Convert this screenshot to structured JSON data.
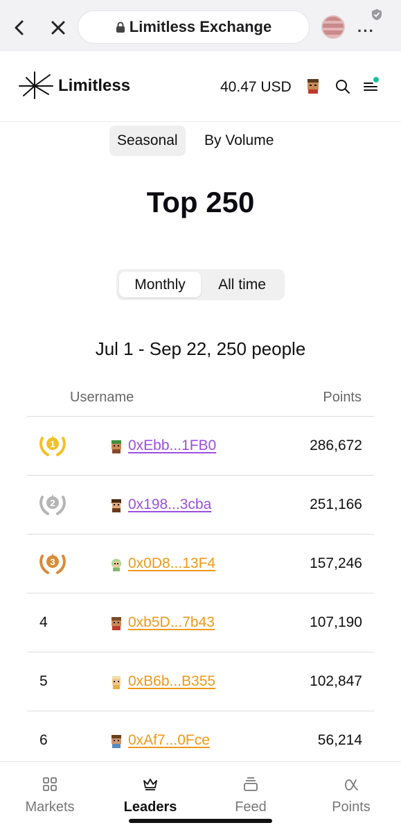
{
  "browser": {
    "url_title": "Limitless Exchange",
    "more_label": "···"
  },
  "header": {
    "brand": "Limitless",
    "balance": "40.47 USD"
  },
  "tabs": [
    {
      "label": "Seasonal",
      "active": true
    },
    {
      "label": "By Volume",
      "active": false
    }
  ],
  "title": "Top 250",
  "period_toggle": [
    {
      "label": "Monthly",
      "active": true
    },
    {
      "label": "All time",
      "active": false
    }
  ],
  "period_summary": "Jul 1 - Sep 22, 250 people",
  "table": {
    "columns": [
      "Username",
      "Points"
    ],
    "rows": [
      {
        "rank": "1",
        "medal": "gold",
        "address": "0xEbb...1FB0",
        "address_color": "purple",
        "points": "286,672"
      },
      {
        "rank": "2",
        "medal": "silver",
        "address": "0x198...3cba",
        "address_color": "purple",
        "points": "251,166"
      },
      {
        "rank": "3",
        "medal": "bronze",
        "address": "0x0D8...13F4",
        "address_color": "orange",
        "points": "157,246"
      },
      {
        "rank": "4",
        "medal": "",
        "address": "0xb5D...7b43",
        "address_color": "orange",
        "points": "107,190"
      },
      {
        "rank": "5",
        "medal": "",
        "address": "0xB6b...B355",
        "address_color": "orange",
        "points": "102,847"
      },
      {
        "rank": "6",
        "medal": "",
        "address": "0xAf7...0Fce",
        "address_color": "orange",
        "points": "56,214"
      }
    ]
  },
  "bottom_nav": [
    {
      "label": "Markets",
      "icon": "grid-icon",
      "active": false
    },
    {
      "label": "Leaders",
      "icon": "crown-icon",
      "active": true
    },
    {
      "label": "Feed",
      "icon": "stack-icon",
      "active": false
    },
    {
      "label": "Points",
      "icon": "alpha-icon",
      "active": false
    }
  ],
  "colors": {
    "accent_purple": "#9b4fe0",
    "accent_orange": "#ef9818",
    "gold": "#f2c027",
    "silver": "#b5b5b5",
    "bronze": "#d98b3a",
    "notification_dot": "#19c39a"
  }
}
